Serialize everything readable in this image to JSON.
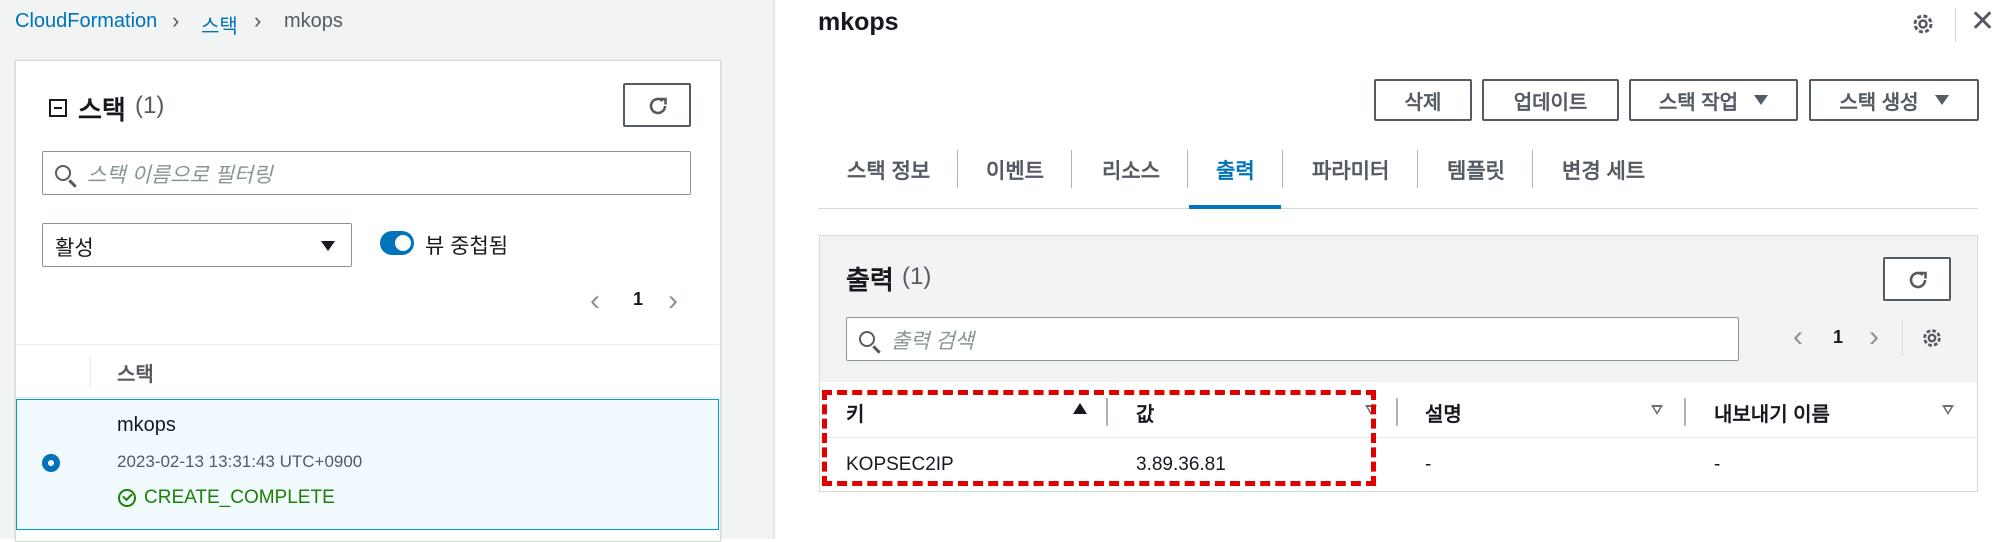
{
  "breadcrumb": {
    "root": "CloudFormation",
    "level2": "스택",
    "current": "mkops"
  },
  "left_panel": {
    "collapse_icon": "collapse-square-icon",
    "title": "스택",
    "count": "(1)",
    "refresh_icon": "refresh-icon",
    "search_placeholder": "스택 이름으로 필터링",
    "status_select": "활성",
    "toggle_label": "뷰 중첩됨",
    "toggle_on": true,
    "page_number": "1",
    "column_header": "스택",
    "stacks": [
      {
        "name": "mkops",
        "timestamp": "2023-02-13 13:31:43 UTC+0900",
        "status": "CREATE_COMPLETE",
        "selected": true
      }
    ]
  },
  "detail": {
    "title": "mkops",
    "buttons": {
      "delete": "삭제",
      "update": "업데이트",
      "stack_actions": "스택 작업",
      "create_stack": "스택 생성"
    },
    "tabs": [
      "스택 정보",
      "이벤트",
      "리소스",
      "출력",
      "파라미터",
      "템플릿",
      "변경 세트"
    ],
    "active_tab": "출력",
    "outputs": {
      "title": "출력",
      "count": "(1)",
      "search_placeholder": "출력 검색",
      "page_number": "1",
      "columns": {
        "key": "키",
        "value": "값",
        "description": "설명",
        "export_name": "내보내기 이름"
      },
      "rows": [
        {
          "key": "KOPSEC2IP",
          "value": "3.89.36.81",
          "description": "-",
          "export_name": "-"
        }
      ]
    }
  },
  "colors": {
    "link": "#0073bb",
    "active_tab": "#0073bb",
    "success": "#1d8102",
    "highlight_box": "#e00000",
    "selected_row_bg": "#f1faff",
    "selected_row_border": "#00a1c9"
  }
}
